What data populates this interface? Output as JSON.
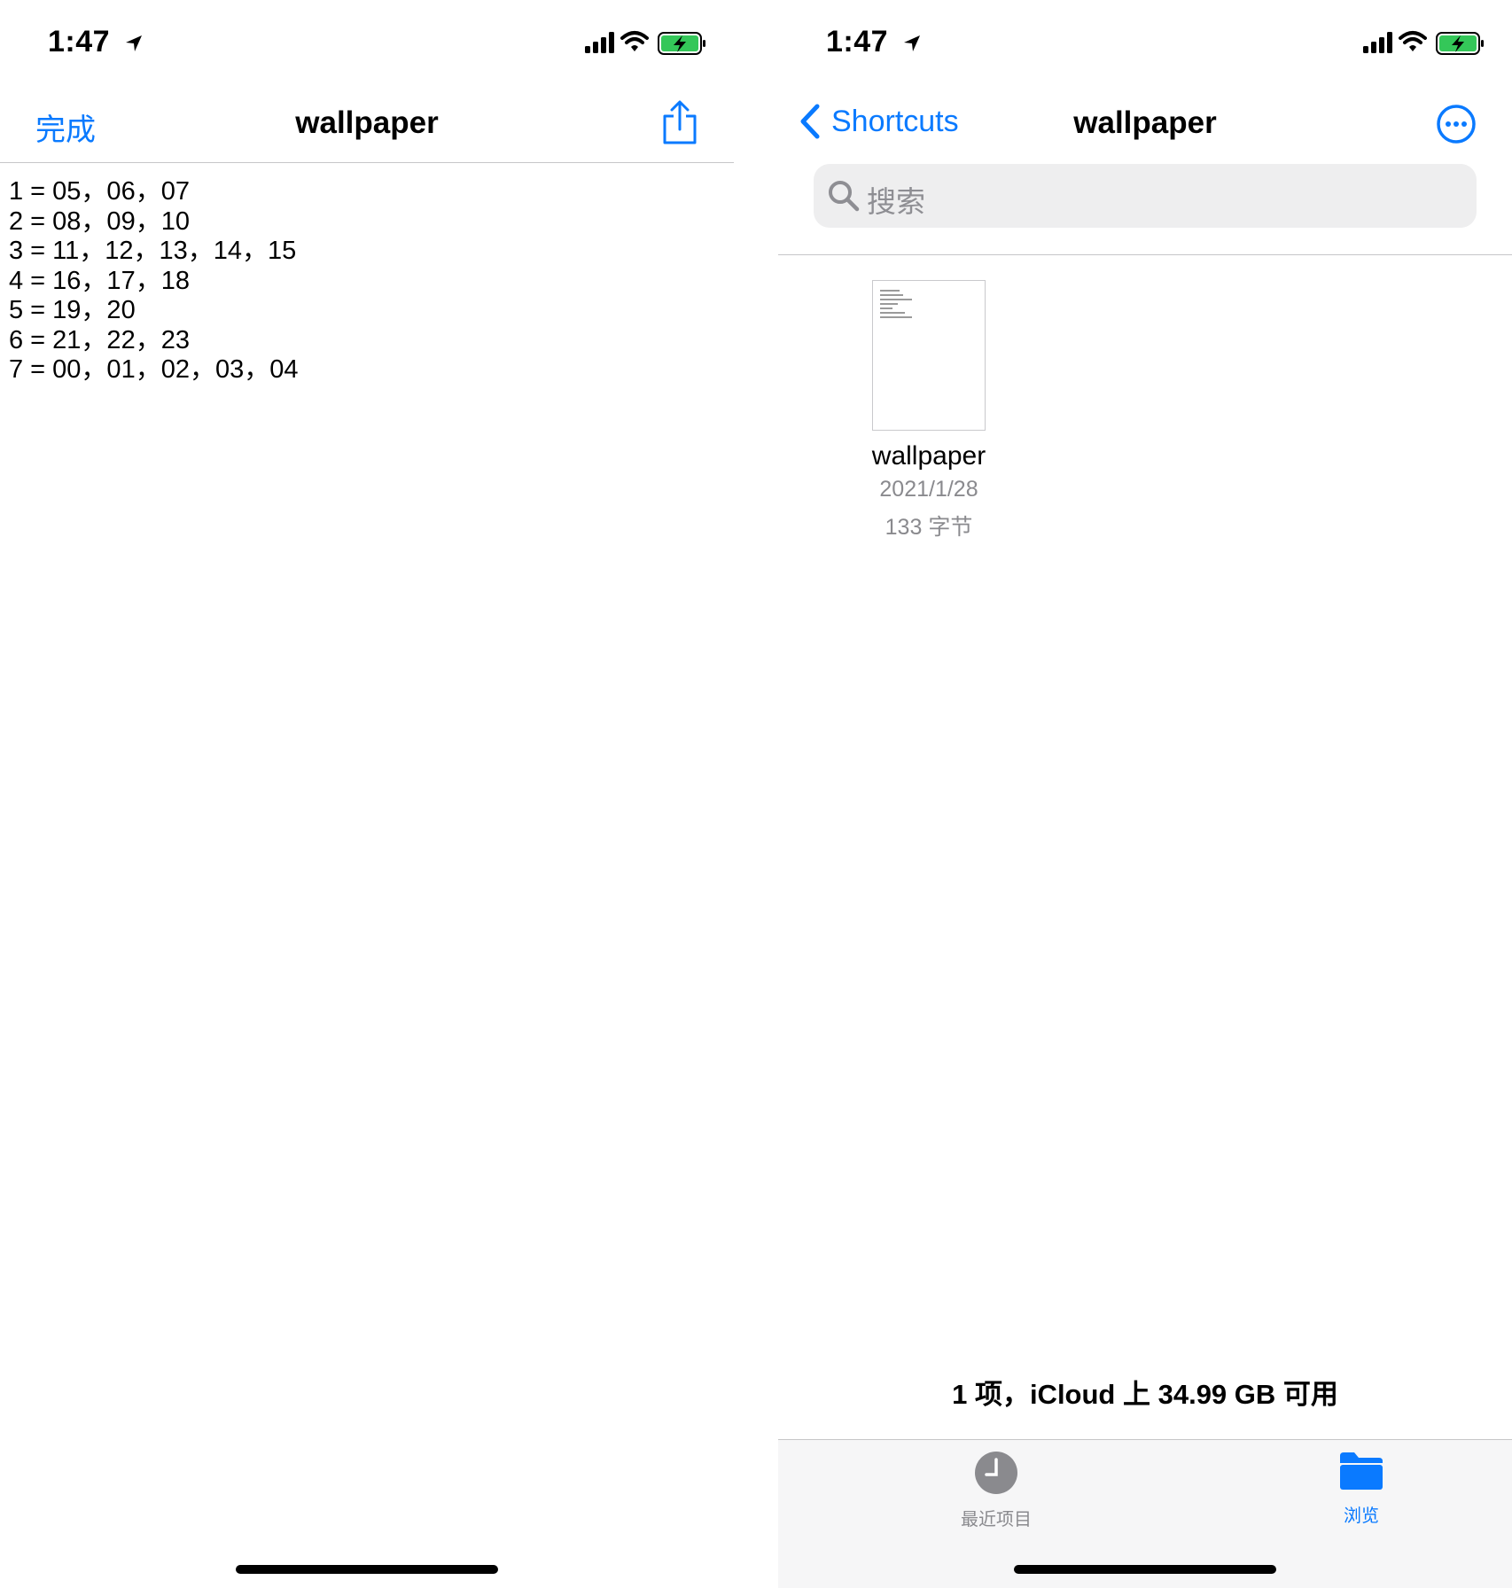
{
  "left_screen": {
    "status": {
      "time": "1:47"
    },
    "nav": {
      "done_label": "完成",
      "title": "wallpaper"
    },
    "document_lines": [
      "1 = 05，06，07",
      "2 = 08，09，10",
      "3 = 11，12，13，14，15",
      "4 = 16，17，18",
      "5 = 19，20",
      "6 = 21，22，23",
      "7 = 00，01，02，03，04"
    ]
  },
  "right_screen": {
    "status": {
      "time": "1:47"
    },
    "nav": {
      "back_label": "Shortcuts",
      "title": "wallpaper"
    },
    "search": {
      "placeholder": "搜索"
    },
    "files": [
      {
        "name": "wallpaper",
        "date": "2021/1/28",
        "size": "133 字节"
      }
    ],
    "storage_summary": "1 项，iCloud 上 34.99 GB 可用",
    "tabs": [
      {
        "label": "最近项目",
        "icon": "clock-icon",
        "selected": false
      },
      {
        "label": "浏览",
        "icon": "folder-icon",
        "selected": true
      }
    ]
  },
  "colors": {
    "accent": "#0A7AFF",
    "battery_green": "#34C759",
    "secondary_text": "#8A8A8E"
  }
}
